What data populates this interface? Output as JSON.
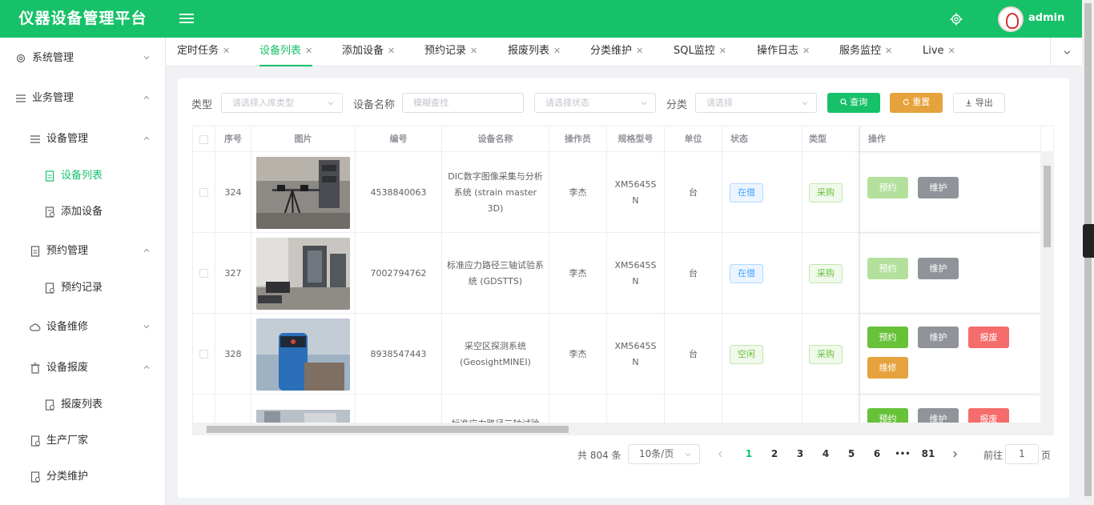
{
  "app": {
    "title": "仪器设备管理平台",
    "user": "admin"
  },
  "colors": {
    "brand": "#17c169",
    "warning": "#e6a23c",
    "danger": "#f56c6c",
    "info": "#909399"
  },
  "sidebar": {
    "items": [
      {
        "label": "系统管理",
        "icon": "gear-icon",
        "arrow": "down"
      },
      {
        "label": "业务管理",
        "icon": "menu-icon",
        "arrow": "up"
      },
      {
        "label": "设备管理",
        "icon": "menu-icon",
        "arrow": "up"
      },
      {
        "label": "设备列表",
        "icon": "document-icon",
        "active": true
      },
      {
        "label": "添加设备",
        "icon": "document-add-icon"
      },
      {
        "label": "预约管理",
        "icon": "document-icon",
        "arrow": "up"
      },
      {
        "label": "预约记录",
        "icon": "document-icon"
      },
      {
        "label": "设备维修",
        "icon": "cloud-icon",
        "arrow": "down"
      },
      {
        "label": "设备报废",
        "icon": "trash-icon",
        "arrow": "up"
      },
      {
        "label": "报废列表",
        "icon": "document-icon"
      },
      {
        "label": "生产厂家",
        "icon": "document-icon"
      },
      {
        "label": "分类维护",
        "icon": "document-icon"
      }
    ]
  },
  "tabs": [
    {
      "label": "定时任务"
    },
    {
      "label": "设备列表",
      "active": true
    },
    {
      "label": "添加设备"
    },
    {
      "label": "预约记录"
    },
    {
      "label": "报废列表"
    },
    {
      "label": "分类维护"
    },
    {
      "label": "SQL监控"
    },
    {
      "label": "操作日志"
    },
    {
      "label": "服务监控"
    },
    {
      "label": "Live"
    }
  ],
  "filters": {
    "type_label": "类型",
    "type_placeholder": "请选择入库类型",
    "name_label": "设备名称",
    "name_placeholder": "模糊查找",
    "status_placeholder": "请选择状态",
    "category_label": "分类",
    "category_placeholder": "请选择",
    "query": "查询",
    "reset": "重置",
    "export": "导出"
  },
  "table": {
    "columns": [
      "序号",
      "图片",
      "编号",
      "设备名称",
      "操作员",
      "规格型号",
      "单位",
      "状态",
      "类型",
      "操作"
    ],
    "rows": [
      {
        "index": "324",
        "code": "4538840063",
        "name": "DIC数字图像采集与分析系统 (strain master 3D)",
        "operator": "李杰",
        "model": "XM5645SN",
        "unit": "台",
        "status": "在借",
        "type": "采购",
        "actions": [
          "预约",
          "维护"
        ]
      },
      {
        "index": "327",
        "code": "7002794762",
        "name": "标准应力路径三轴试验系统 (GDSTTS)",
        "operator": "李杰",
        "model": "XM5645SN",
        "unit": "台",
        "status": "在借",
        "type": "采购",
        "actions": [
          "预约",
          "维护"
        ]
      },
      {
        "index": "328",
        "code": "8938547443",
        "name": "采空区探测系统 (GeosightMINEI)",
        "operator": "李杰",
        "model": "XM5645SN",
        "unit": "台",
        "status": "空闲",
        "type": "采购",
        "actions": [
          "预约",
          "维护",
          "报废",
          "维修"
        ]
      },
      {
        "name": "标准应力路径三轴试验",
        "actions": [
          "预约",
          "维护",
          "报废"
        ]
      }
    ]
  },
  "pagination": {
    "total": "共 804 条",
    "page_size": "10条/页",
    "pages": [
      "1",
      "2",
      "3",
      "4",
      "5",
      "6",
      "•••",
      "81"
    ],
    "current": "1",
    "goto_prefix": "前往",
    "goto_value": "1",
    "goto_suffix": "页"
  }
}
